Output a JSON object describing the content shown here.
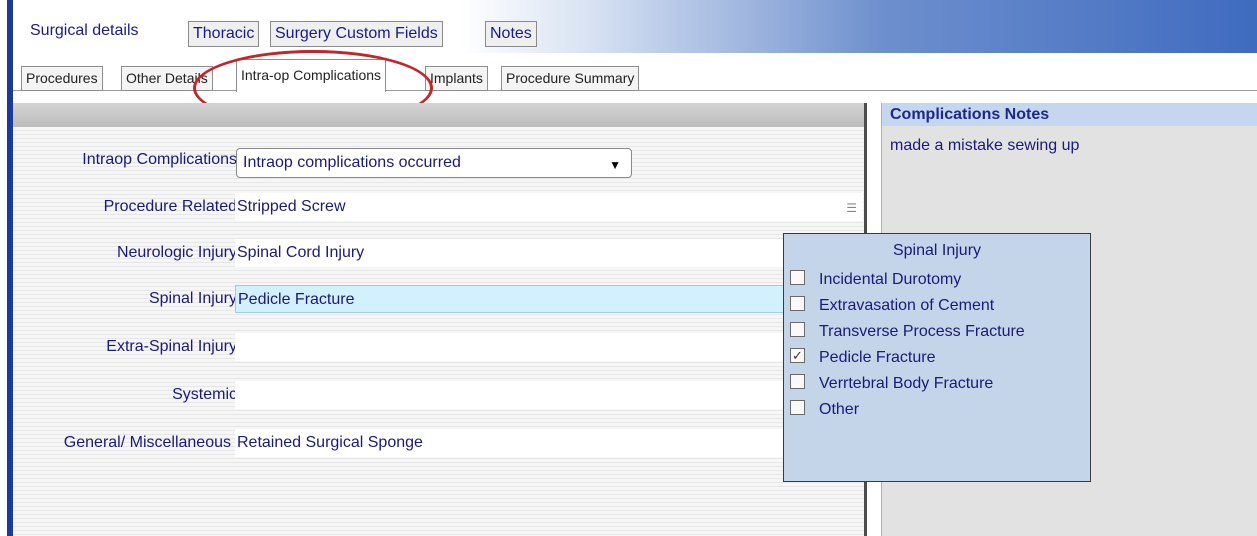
{
  "main_tabs": [
    {
      "label": "Surgical details",
      "active": true
    },
    {
      "label": "Thoracic",
      "active": false
    },
    {
      "label": "Surgery Custom Fields",
      "active": false
    },
    {
      "label": "Notes",
      "active": false
    }
  ],
  "sub_tabs": [
    {
      "label": "Procedures",
      "active": false
    },
    {
      "label": "Other Details",
      "active": false
    },
    {
      "label": "Intra-op Complications",
      "active": true
    },
    {
      "label": "Implants",
      "active": false
    },
    {
      "label": "Procedure Summary",
      "active": false
    }
  ],
  "form": {
    "intraop_label": "Intraop Complications",
    "intraop_value": "Intraop complications occurred",
    "rows": [
      {
        "label": "Procedure Related",
        "value": "Stripped Screw"
      },
      {
        "label": "Neurologic Injury",
        "value": "Spinal Cord Injury"
      },
      {
        "label": "Spinal Injury",
        "value": "Pedicle Fracture"
      },
      {
        "label": "Extra-Spinal Injury",
        "value": ""
      },
      {
        "label": "Systemic",
        "value": ""
      },
      {
        "label": "General/ Miscellaneous",
        "value": "Retained Surgical Sponge"
      }
    ]
  },
  "notes": {
    "header": "Complications Notes",
    "text": "made a mistake sewing up"
  },
  "popup": {
    "title": "Spinal Injury",
    "items": [
      {
        "label": "Incidental Durotomy",
        "checked": false
      },
      {
        "label": "Extravasation of Cement",
        "checked": false
      },
      {
        "label": "Transverse Process Fracture",
        "checked": false
      },
      {
        "label": "Pedicle Fracture",
        "checked": true
      },
      {
        "label": "Verrtebral Body Fracture",
        "checked": false
      },
      {
        "label": "Other",
        "checked": false
      }
    ]
  },
  "colors": {
    "accent": "#1b3a9c",
    "annotation": "#c0262c",
    "highlight": "#d3f0ff",
    "popup_bg": "#c4d5ea"
  }
}
